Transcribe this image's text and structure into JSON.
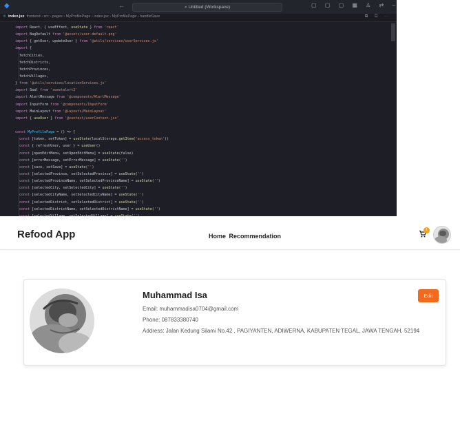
{
  "editor": {
    "search_text": "Untitled (Workspace)",
    "nav_arrows": "← →",
    "window_controls": "▢ ▢ ▢ ▦ ♙ ⇄  –  ▢  ✕",
    "tab_file": "index.jsx",
    "tab_path": "frontend › src › pages › MyProfilePage › index.jsx › MyProfilePage › handleSave",
    "tab_icons": "⧉ ◫ ⋯",
    "code_lines": [
      "import React, { useEffect, useState } from 'react'",
      "import BagDefault from '@assets/user-default.png'",
      "import { getUser, updateUser } from '@utils/services/userServices.js'",
      "import {",
      "  fetchCities,",
      "  fetchDistricts,",
      "  fetchProvinces,",
      "  fetchVillages,",
      "} from '@utils/services/locationServices.js'",
      "import Swal from 'sweetalert2'",
      "import AlertMessage from '@components/AlertMessage'",
      "import InputForm from '@components/InputForm'",
      "import MainLayout from '@Layouts/MainLayout'",
      "import { useUser } from '@context/userContext.jsx'",
      "",
      "const MyProfilePage = () => {",
      "  const [token, setToken] = useState(localStorage.getItem('access_token'))",
      "  const { refreshUser, user } = useUser()",
      "  const [openEditMenu, setOpenEditMenu] = useState(false)",
      "  const [errorMessage, setErrorMessage] = useState('')",
      "  const [save, setSave] = useState('')",
      "  const [selectedProvince, setSelectedProvince] = useState('')",
      "  const [selectedProvinceName, setSelectedProvinceName] = useState('')",
      "  const [selectedCity, setSelectedCity] = useState('')",
      "  const [selectedCityName, setSelectedCityName] = useState('')",
      "  const [selectedDistrict, setSelectedDistrict] = useState('')",
      "  const [selectedDistrictName, setSelectedDistrictName] = useState('')",
      "  const [selectedVillage, setSelectedVillage] = useState('')"
    ]
  },
  "app": {
    "brand": "Refood App",
    "nav": {
      "home": "Home",
      "recommendation": "Recommendation"
    },
    "cart_count": "1",
    "profile": {
      "name": "Muhammad Isa",
      "email": "Email: muhammadisa0704@gmail.com",
      "phone": "Phone: 087833380740",
      "address": "Address: Jalan Kedung Silami No.42 , PAGIYANTEN, ADIWERNA, KABUPATEN TEGAL, JAWA TENGAH, 52194",
      "edit_label": "Edit"
    },
    "colors": {
      "edit_button": "#f26b1d",
      "cart_badge": "#f4a11b"
    }
  }
}
